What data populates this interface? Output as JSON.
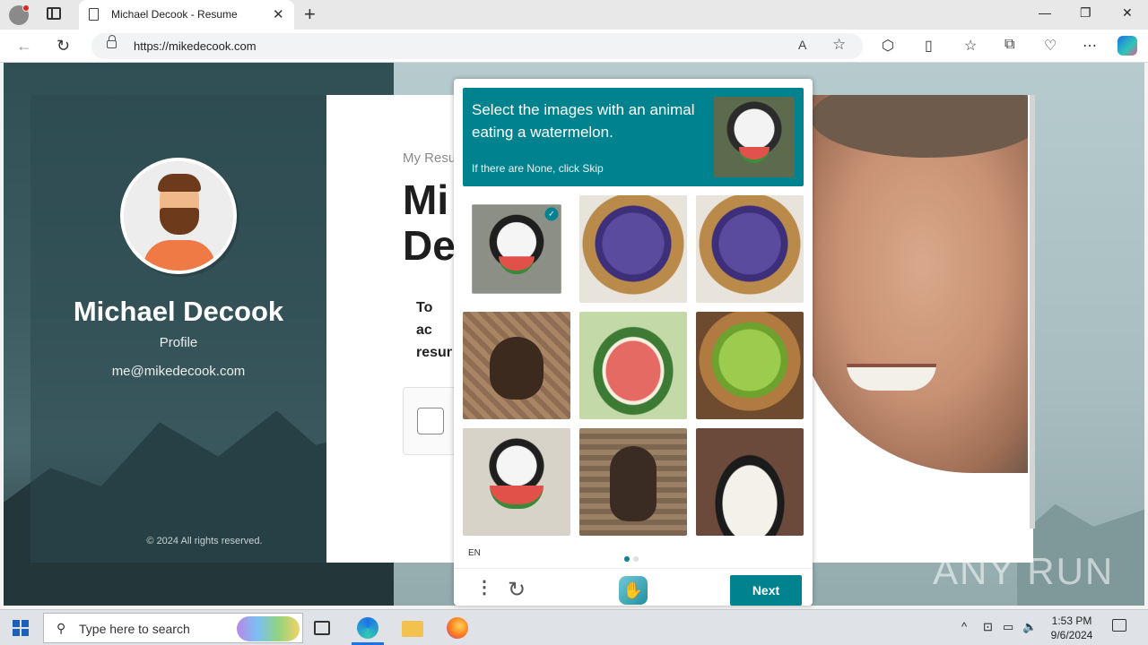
{
  "browser": {
    "tab_title": "Michael Decook - Resume",
    "url": "https://mikedecook.com",
    "tab_close": "✕",
    "new_tab": "+",
    "minimize": "—",
    "maximize": "❐",
    "close": "✕"
  },
  "sidebar": {
    "name": "Michael Decook",
    "role": "Profile",
    "email": "me@mikedecook.com",
    "copyright": "© 2024 All rights reserved."
  },
  "resume": {
    "subtitle": "My Resu",
    "title": "Mi De",
    "message": "To ac resun"
  },
  "captcha": {
    "prompt": "Select the images with an animal eating a watermelon.",
    "hint": "If there are None, click Skip",
    "language": "EN",
    "next_label": "Next",
    "tiles": [
      {
        "subject": "panda-eating-watermelon",
        "selected": true
      },
      {
        "subject": "basket-of-purple-grapes",
        "selected": false
      },
      {
        "subject": "basket-of-purple-grapes",
        "selected": false
      },
      {
        "subject": "bear-on-patterned-background",
        "selected": false
      },
      {
        "subject": "watermelon-slices",
        "selected": false
      },
      {
        "subject": "basket-of-green-grapes",
        "selected": false
      },
      {
        "subject": "panda-eating-watermelon",
        "selected": false
      },
      {
        "subject": "bear-on-patterned-background",
        "selected": false
      },
      {
        "subject": "panda-closeup",
        "selected": false
      }
    ],
    "page_dots": 2,
    "active_page": 1,
    "accent_color": "#00838f"
  },
  "watermark": "ANY RUN",
  "taskbar": {
    "search_placeholder": "Type here to search",
    "time": "1:53 PM",
    "date": "9/6/2024"
  }
}
